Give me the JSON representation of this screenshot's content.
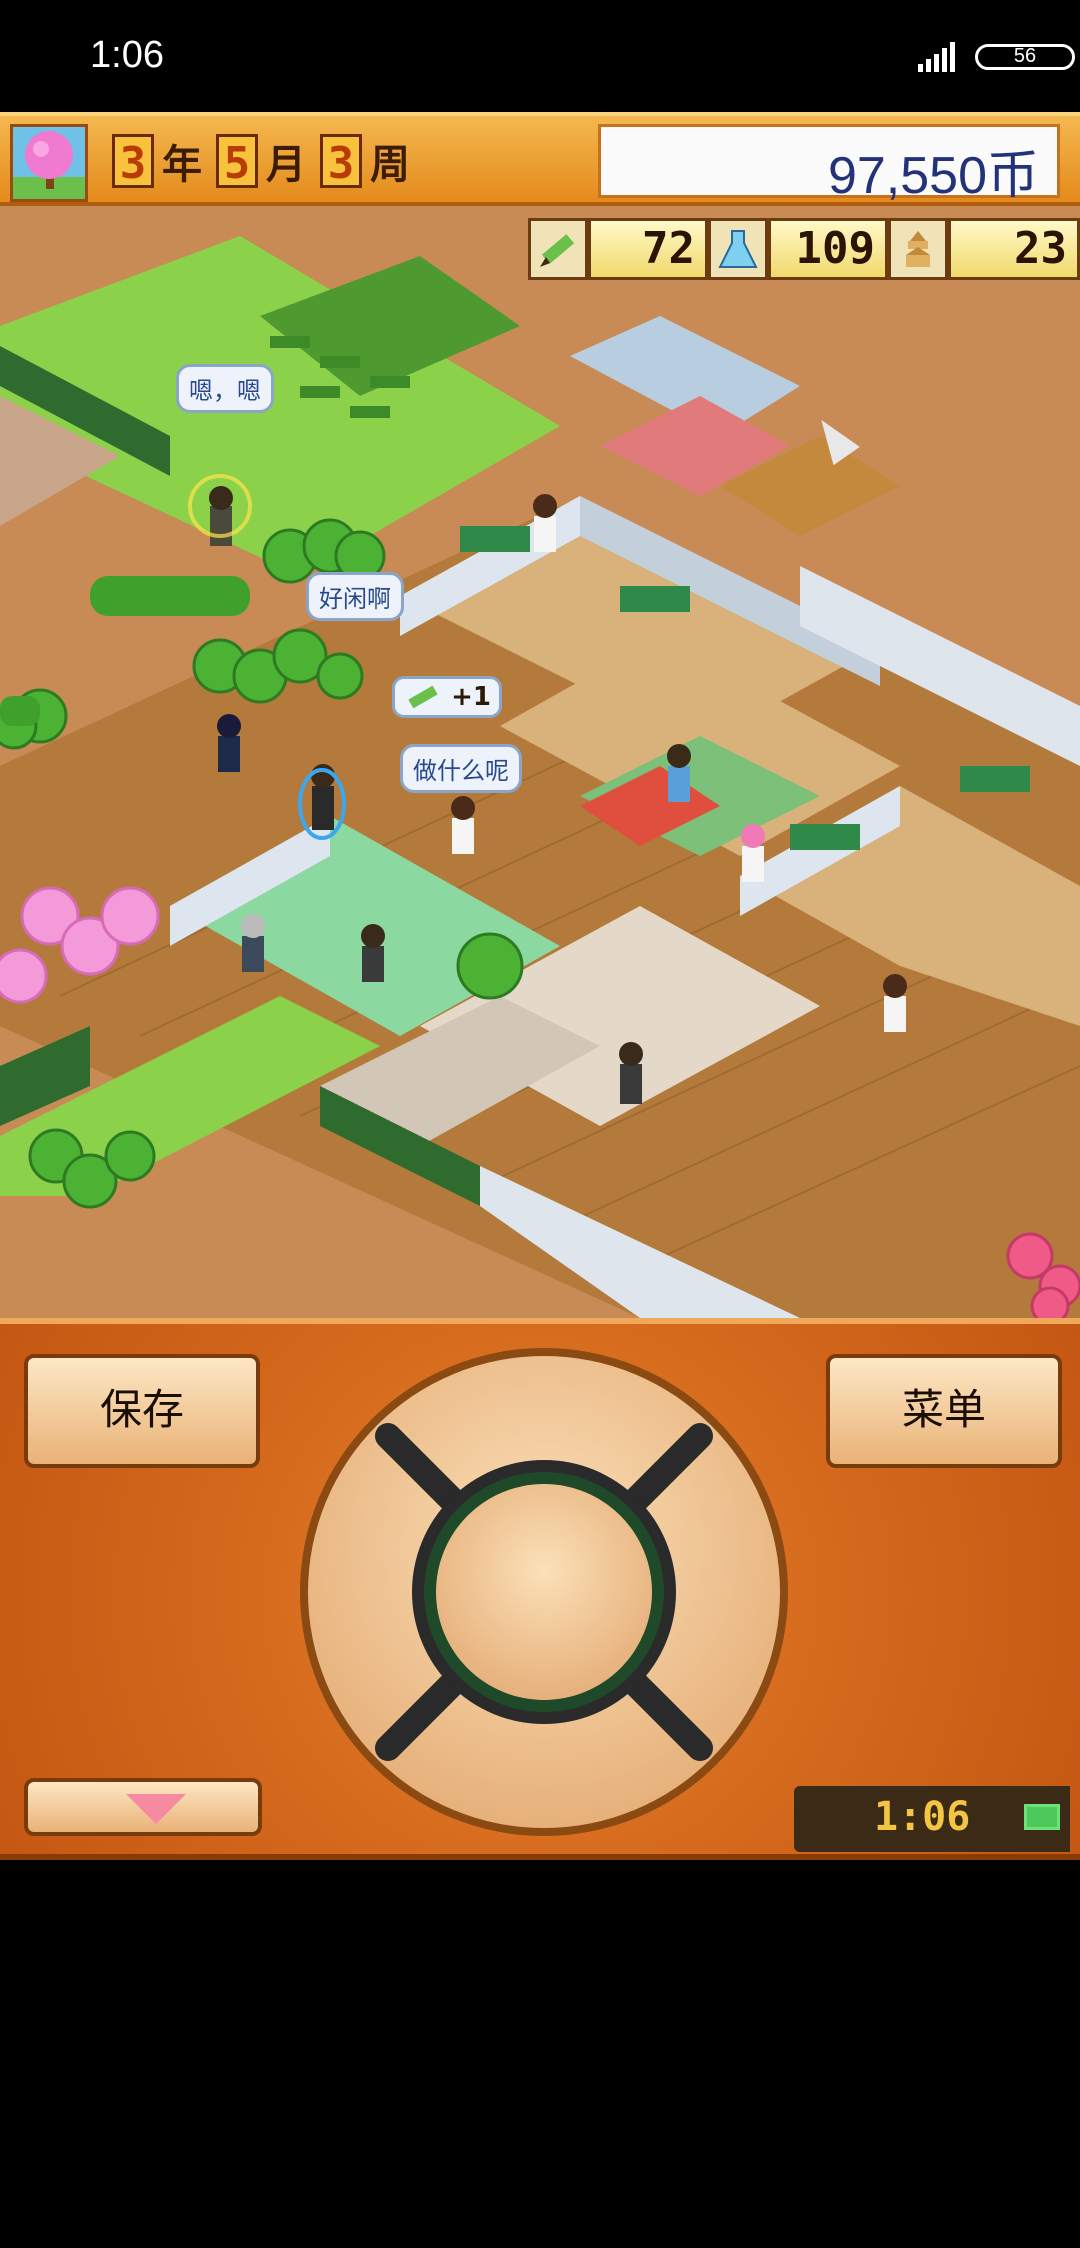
{
  "status_bar": {
    "time": "1:06",
    "battery_level": "56"
  },
  "top_bar": {
    "year_num": "3",
    "year_unit": "年",
    "month_num": "5",
    "month_unit": "月",
    "week_num": "3",
    "week_unit": "周",
    "money": "97,550币"
  },
  "stats": [
    {
      "icon": "pencil-icon",
      "value": "72"
    },
    {
      "icon": "flask-icon",
      "value": "109"
    },
    {
      "icon": "pagoda-icon",
      "value": "23"
    }
  ],
  "speech_bubbles": {
    "bubble1": "嗯，嗯",
    "bubble2": "好闲啊",
    "bubble3": "做什么呢",
    "bonus": "+1"
  },
  "controls": {
    "save_label": "保存",
    "menu_label": "菜单",
    "clock": "1:06"
  },
  "colors": {
    "accent_orange": "#e48a1c",
    "money_text": "#24327a",
    "bubble_text": "#284a8c"
  }
}
